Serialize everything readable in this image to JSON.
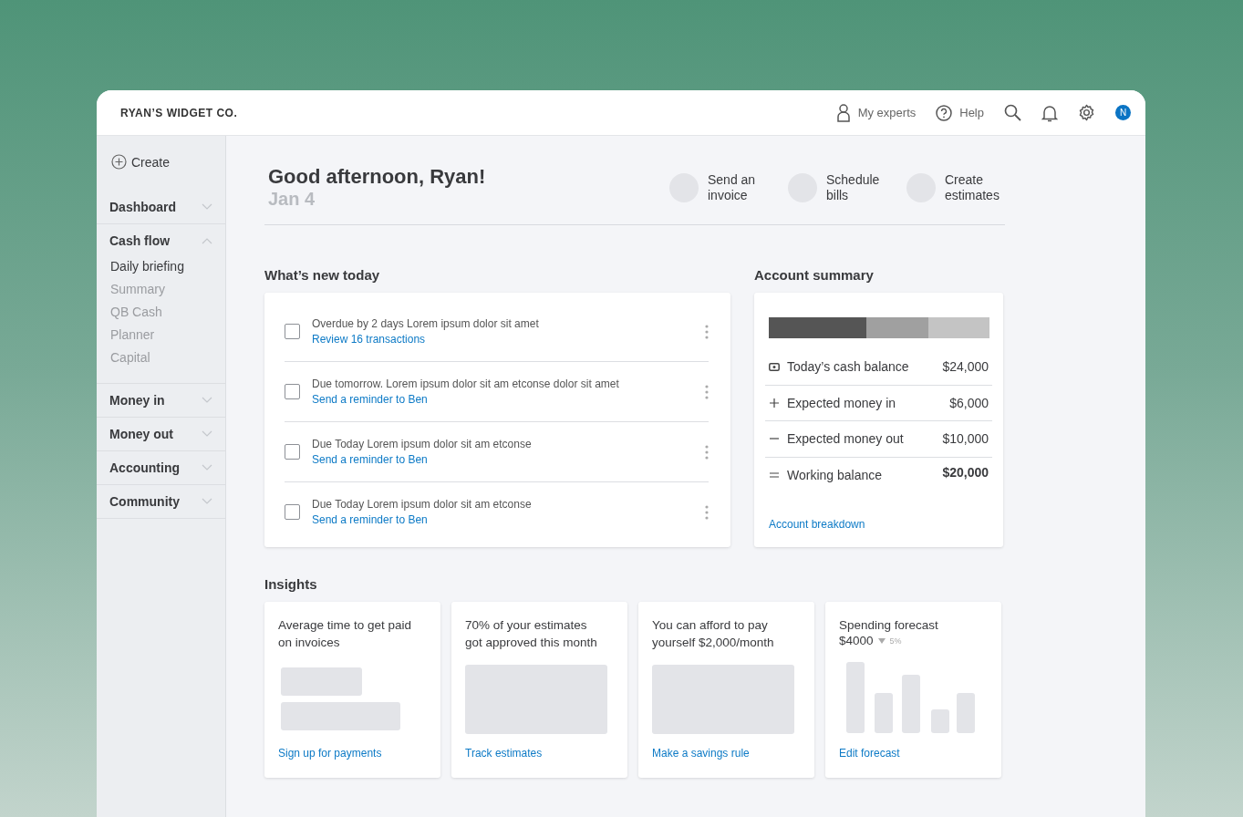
{
  "company": "RYAN’S WIDGET CO.",
  "header_actions": [
    {
      "kind": "experts",
      "label": "My experts"
    },
    {
      "kind": "help",
      "label": "Help"
    },
    {
      "kind": "search"
    },
    {
      "kind": "bell"
    },
    {
      "kind": "gear"
    },
    {
      "kind": "avatar",
      "label": "N"
    }
  ],
  "sidebar": {
    "create": "Create",
    "sections": [
      {
        "label": "Dashboard",
        "expanded": false
      },
      {
        "label": "Cash flow",
        "expanded": true,
        "children": [
          {
            "label": "Daily briefing",
            "selected": true
          },
          {
            "label": "Summary",
            "selected": false
          },
          {
            "label": "QB Cash",
            "selected": false
          },
          {
            "label": "Planner",
            "selected": false
          },
          {
            "label": "Capital",
            "selected": false
          }
        ]
      },
      {
        "label": "Money in",
        "expanded": false
      },
      {
        "label": "Money out",
        "expanded": false
      },
      {
        "label": "Accounting",
        "expanded": false
      },
      {
        "label": "Community",
        "expanded": false
      }
    ]
  },
  "greeting": {
    "title": "Good afternoon, Ryan!",
    "date": "Jan 4"
  },
  "quick_actions": [
    "Send an invoice",
    "Schedule bills",
    "Create estimates"
  ],
  "whats_new": {
    "title": "What’s new today",
    "items": [
      {
        "text": "Overdue by 2 days Lorem ipsum dolor sit amet",
        "link": "Review 16 transactions",
        "checked": false
      },
      {
        "text": "Due tomorrow. Lorem ipsum dolor sit am etconse dolor sit amet",
        "link": "Send a reminder to Ben",
        "checked": false
      },
      {
        "text": "Due Today Lorem ipsum dolor sit am etconse",
        "link": "Send a reminder to Ben",
        "checked": false
      },
      {
        "text": "Due Today Lorem ipsum dolor sit am etconse",
        "link": "Send a reminder to Ben",
        "checked": false
      }
    ]
  },
  "account_summary": {
    "title": "Account summary",
    "rows": [
      {
        "kind": "cash",
        "label": "Today’s cash balance",
        "amount": "$24,000"
      },
      {
        "kind": "plus",
        "label": "Expected money in",
        "amount": "$6,000"
      },
      {
        "kind": "minus",
        "label": "Expected money out",
        "amount": "$10,000"
      },
      {
        "kind": "equals",
        "label": "Working balance",
        "amount": "$20,000"
      }
    ],
    "link": "Account breakdown"
  },
  "insights": {
    "title": "Insights",
    "cards": [
      {
        "kind": "two-blocks",
        "text": "Average time to get paid on invoices",
        "link": "Sign up for payments"
      },
      {
        "kind": "block",
        "text": "70% of your estimates got approved this month",
        "link": "Track estimates"
      },
      {
        "kind": "block",
        "text": "You can afford to pay yourself $2,000/month",
        "link": "Make a savings rule"
      },
      {
        "kind": "bars",
        "text": "Spending forecast",
        "amount": "$4000",
        "change": "5%",
        "link": "Edit forecast"
      }
    ]
  }
}
